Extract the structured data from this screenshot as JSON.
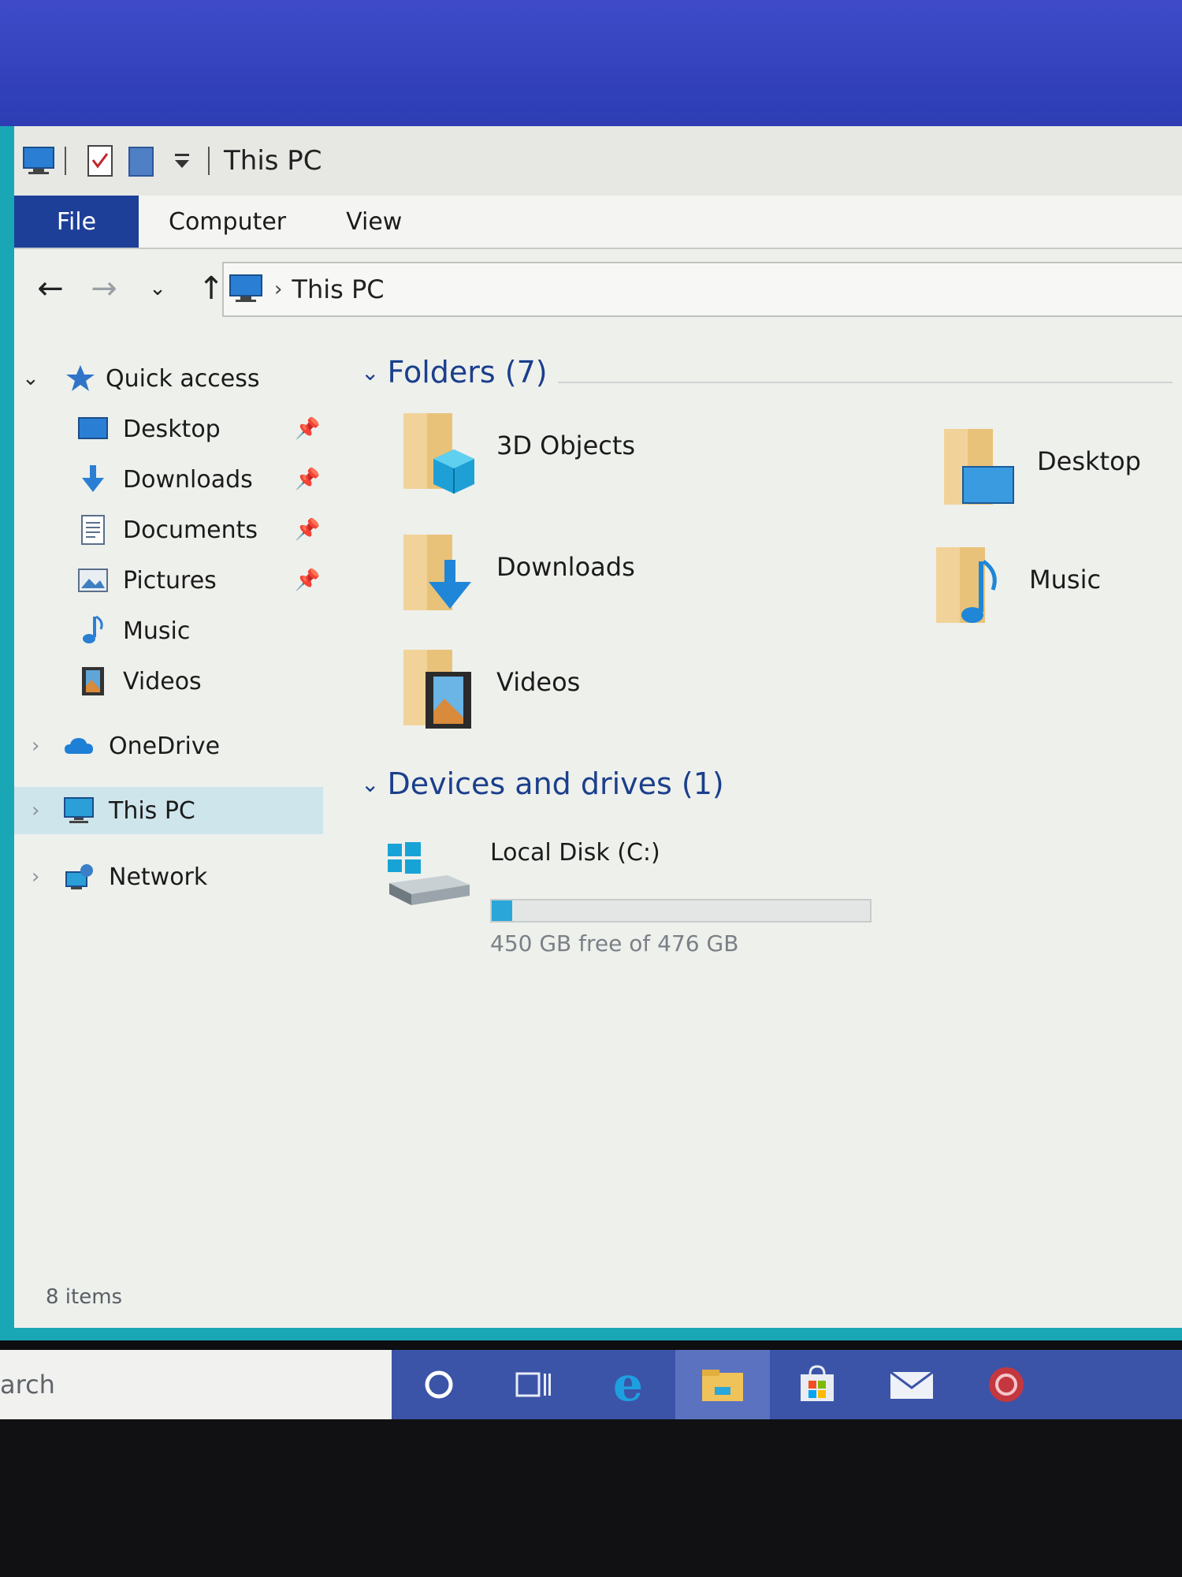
{
  "window": {
    "title": "This PC"
  },
  "ribbon": {
    "tabs": [
      "File",
      "Computer",
      "View"
    ]
  },
  "address": {
    "path": "This PC"
  },
  "sidebar": {
    "quick_access": "Quick access",
    "items": [
      {
        "label": "Desktop",
        "pinned": true,
        "icon": "desktop-icon"
      },
      {
        "label": "Downloads",
        "pinned": true,
        "icon": "download-arrow-icon"
      },
      {
        "label": "Documents",
        "pinned": true,
        "icon": "document-icon"
      },
      {
        "label": "Pictures",
        "pinned": true,
        "icon": "picture-icon"
      },
      {
        "label": "Music",
        "pinned": false,
        "icon": "music-note-icon"
      },
      {
        "label": "Videos",
        "pinned": false,
        "icon": "film-icon"
      }
    ],
    "onedrive": "OneDrive",
    "thispc": "This PC",
    "network": "Network"
  },
  "content": {
    "folders_header": "Folders (7)",
    "folders": [
      "3D Objects",
      "Desktop",
      "Downloads",
      "Music",
      "Videos"
    ],
    "devices_header": "Devices and drives (1)",
    "drive": {
      "name": "Local Disk (C:)",
      "free_text": "450 GB free of 476 GB",
      "used_fraction": 0.055
    }
  },
  "status": {
    "items": "8 items"
  },
  "taskbar": {
    "search_text": "arch"
  },
  "colors": {
    "accent": "#1d3f98",
    "selection": "#cfe5ec",
    "header_blue": "#1b3f8c",
    "drive_fill": "#2aa6d8"
  }
}
